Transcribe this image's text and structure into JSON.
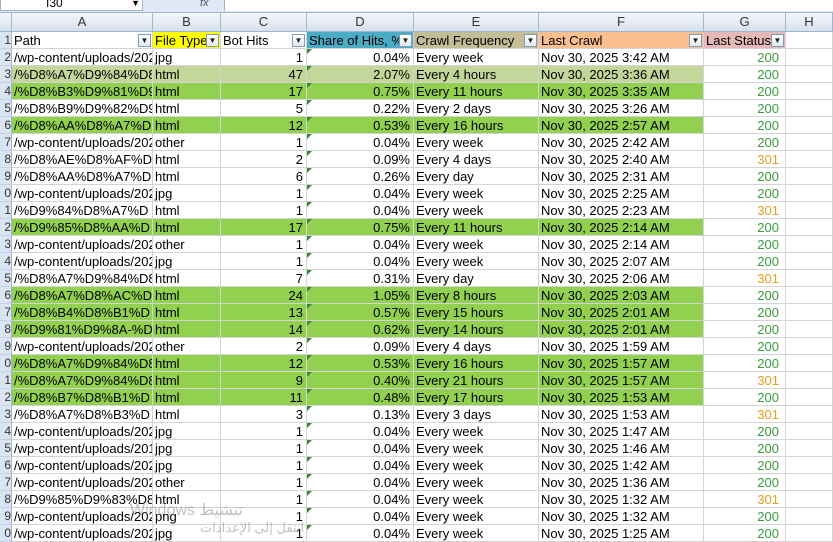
{
  "name_box": "I30",
  "fx_label": "fx",
  "column_letters": [
    "A",
    "B",
    "C",
    "D",
    "E",
    "F",
    "G",
    "H"
  ],
  "headers": {
    "path": "Path",
    "file_type": "File Type",
    "bot_hits": "Bot Hits",
    "share": "Share of Hits, %",
    "crawl_frequency": "Crawl Frequency",
    "last_crawl": "Last Crawl",
    "last_status": "Last Status"
  },
  "header_colors": {
    "file_type": "#ffff00",
    "share": "#4bacc6",
    "crawl_frequency": "#c4bd97",
    "last_crawl": "#fabf8f",
    "last_status": "#e6b9b8"
  },
  "row_numbers": [
    "1",
    "2",
    "3",
    "4",
    "5",
    "6",
    "7",
    "8",
    "9",
    "0",
    "1",
    "2",
    "3",
    "4",
    "5",
    "6",
    "7",
    "8",
    "9",
    "0",
    "1",
    "2",
    "3",
    "4",
    "5",
    "6",
    "7",
    "8",
    "9",
    "0"
  ],
  "rows": [
    {
      "path": "/wp-content/uploads/202",
      "type": "jpg",
      "hits": "1",
      "share": "0.04%",
      "freq": "Every week",
      "crawl": "Nov 30, 2025 3:42 AM",
      "status": "200",
      "fill": "none"
    },
    {
      "path": "/%D8%A7%D9%84%D8",
      "type": "html",
      "hits": "47",
      "share": "2.07%",
      "freq": "Every 4 hours",
      "crawl": "Nov 30, 2025 3:36 AM",
      "status": "200",
      "fill": "light"
    },
    {
      "path": "/%D8%B3%D9%81%D9",
      "type": "html",
      "hits": "17",
      "share": "0.75%",
      "freq": "Every 11 hours",
      "crawl": "Nov 30, 2025 3:35 AM",
      "status": "200",
      "fill": "green"
    },
    {
      "path": "/%D8%B9%D9%82%D9",
      "type": "html",
      "hits": "5",
      "share": "0.22%",
      "freq": "Every 2 days",
      "crawl": "Nov 30, 2025 3:26 AM",
      "status": "200",
      "fill": "none"
    },
    {
      "path": "/%D8%AA%D8%A7%D",
      "type": "html",
      "hits": "12",
      "share": "0.53%",
      "freq": "Every 16 hours",
      "crawl": "Nov 30, 2025 2:57 AM",
      "status": "200",
      "fill": "green"
    },
    {
      "path": "/wp-content/uploads/202",
      "type": "other",
      "hits": "1",
      "share": "0.04%",
      "freq": "Every week",
      "crawl": "Nov 30, 2025 2:42 AM",
      "status": "200",
      "fill": "none"
    },
    {
      "path": "/%D8%AE%D8%AF%D",
      "type": "html",
      "hits": "2",
      "share": "0.09%",
      "freq": "Every 4 days",
      "crawl": "Nov 30, 2025 2:40 AM",
      "status": "301",
      "fill": "none"
    },
    {
      "path": "/%D8%AA%D8%A7%D",
      "type": "html",
      "hits": "6",
      "share": "0.26%",
      "freq": "Every day",
      "crawl": "Nov 30, 2025 2:31 AM",
      "status": "200",
      "fill": "none"
    },
    {
      "path": "/wp-content/uploads/202",
      "type": "jpg",
      "hits": "1",
      "share": "0.04%",
      "freq": "Every week",
      "crawl": "Nov 30, 2025 2:25 AM",
      "status": "200",
      "fill": "none"
    },
    {
      "path": "/%D9%84%D8%A7%D",
      "type": "html",
      "hits": "1",
      "share": "0.04%",
      "freq": "Every week",
      "crawl": "Nov 30, 2025 2:23 AM",
      "status": "301",
      "fill": "none"
    },
    {
      "path": "/%D9%85%D8%AA%D",
      "type": "html",
      "hits": "17",
      "share": "0.75%",
      "freq": "Every 11 hours",
      "crawl": "Nov 30, 2025 2:14 AM",
      "status": "200",
      "fill": "green"
    },
    {
      "path": "/wp-content/uploads/202",
      "type": "other",
      "hits": "1",
      "share": "0.04%",
      "freq": "Every week",
      "crawl": "Nov 30, 2025 2:14 AM",
      "status": "200",
      "fill": "none"
    },
    {
      "path": "/wp-content/uploads/202",
      "type": "jpg",
      "hits": "1",
      "share": "0.04%",
      "freq": "Every week",
      "crawl": "Nov 30, 2025 2:07 AM",
      "status": "200",
      "fill": "none"
    },
    {
      "path": "/%D8%A7%D9%84%D8",
      "type": "html",
      "hits": "7",
      "share": "0.31%",
      "freq": "Every day",
      "crawl": "Nov 30, 2025 2:06 AM",
      "status": "301",
      "fill": "none"
    },
    {
      "path": "/%D8%A7%D8%AC%D",
      "type": "html",
      "hits": "24",
      "share": "1.05%",
      "freq": "Every 8 hours",
      "crawl": "Nov 30, 2025 2:03 AM",
      "status": "200",
      "fill": "green"
    },
    {
      "path": "/%D8%B4%D8%B1%D",
      "type": "html",
      "hits": "13",
      "share": "0.57%",
      "freq": "Every 15 hours",
      "crawl": "Nov 30, 2025 2:01 AM",
      "status": "200",
      "fill": "green"
    },
    {
      "path": "/%D9%81%D9%8A-%D",
      "type": "html",
      "hits": "14",
      "share": "0.62%",
      "freq": "Every 14 hours",
      "crawl": "Nov 30, 2025 2:01 AM",
      "status": "200",
      "fill": "green"
    },
    {
      "path": "/wp-content/uploads/202",
      "type": "other",
      "hits": "2",
      "share": "0.09%",
      "freq": "Every 4 days",
      "crawl": "Nov 30, 2025 1:59 AM",
      "status": "200",
      "fill": "none"
    },
    {
      "path": "/%D8%A7%D9%84%D8",
      "type": "html",
      "hits": "12",
      "share": "0.53%",
      "freq": "Every 16 hours",
      "crawl": "Nov 30, 2025 1:57 AM",
      "status": "200",
      "fill": "green"
    },
    {
      "path": "/%D8%A7%D9%84%D8",
      "type": "html",
      "hits": "9",
      "share": "0.40%",
      "freq": "Every 21 hours",
      "crawl": "Nov 30, 2025 1:57 AM",
      "status": "301",
      "fill": "green"
    },
    {
      "path": "/%D8%B7%D8%B1%D",
      "type": "html",
      "hits": "11",
      "share": "0.48%",
      "freq": "Every 17 hours",
      "crawl": "Nov 30, 2025 1:53 AM",
      "status": "200",
      "fill": "green"
    },
    {
      "path": "/%D8%A7%D8%B3%D",
      "type": "html",
      "hits": "3",
      "share": "0.13%",
      "freq": "Every 3 days",
      "crawl": "Nov 30, 2025 1:53 AM",
      "status": "301",
      "fill": "none"
    },
    {
      "path": "/wp-content/uploads/202",
      "type": "jpg",
      "hits": "1",
      "share": "0.04%",
      "freq": "Every week",
      "crawl": "Nov 30, 2025 1:47 AM",
      "status": "200",
      "fill": "none"
    },
    {
      "path": "/wp-content/uploads/201",
      "type": "jpg",
      "hits": "1",
      "share": "0.04%",
      "freq": "Every week",
      "crawl": "Nov 30, 2025 1:46 AM",
      "status": "200",
      "fill": "none"
    },
    {
      "path": "/wp-content/uploads/202",
      "type": "jpg",
      "hits": "1",
      "share": "0.04%",
      "freq": "Every week",
      "crawl": "Nov 30, 2025 1:42 AM",
      "status": "200",
      "fill": "none"
    },
    {
      "path": "/wp-content/uploads/202",
      "type": "other",
      "hits": "1",
      "share": "0.04%",
      "freq": "Every week",
      "crawl": "Nov 30, 2025 1:36 AM",
      "status": "200",
      "fill": "none"
    },
    {
      "path": "/%D9%85%D9%83%D8",
      "type": "html",
      "hits": "1",
      "share": "0.04%",
      "freq": "Every week",
      "crawl": "Nov 30, 2025 1:32 AM",
      "status": "301",
      "fill": "none"
    },
    {
      "path": "/wp-content/uploads/202",
      "type": "png",
      "hits": "1",
      "share": "0.04%",
      "freq": "Every week",
      "crawl": "Nov 30, 2025 1:32 AM",
      "status": "200",
      "fill": "none"
    },
    {
      "path": "/wp-content/uploads/202",
      "type": "jpg",
      "hits": "1",
      "share": "0.04%",
      "freq": "Every week",
      "crawl": "Nov 30, 2025 1:25 AM",
      "status": "200",
      "fill": "none"
    }
  ],
  "fill_colors": {
    "green": "#92d050",
    "light": "#c4d79b",
    "none": "#ffffff"
  },
  "status_colors": {
    "200": "#3a9a3a",
    "301": "#e0a020"
  },
  "watermark_line1": "Windows تنشيط",
  "watermark_line2": "انتقل إلى الإعدادات"
}
